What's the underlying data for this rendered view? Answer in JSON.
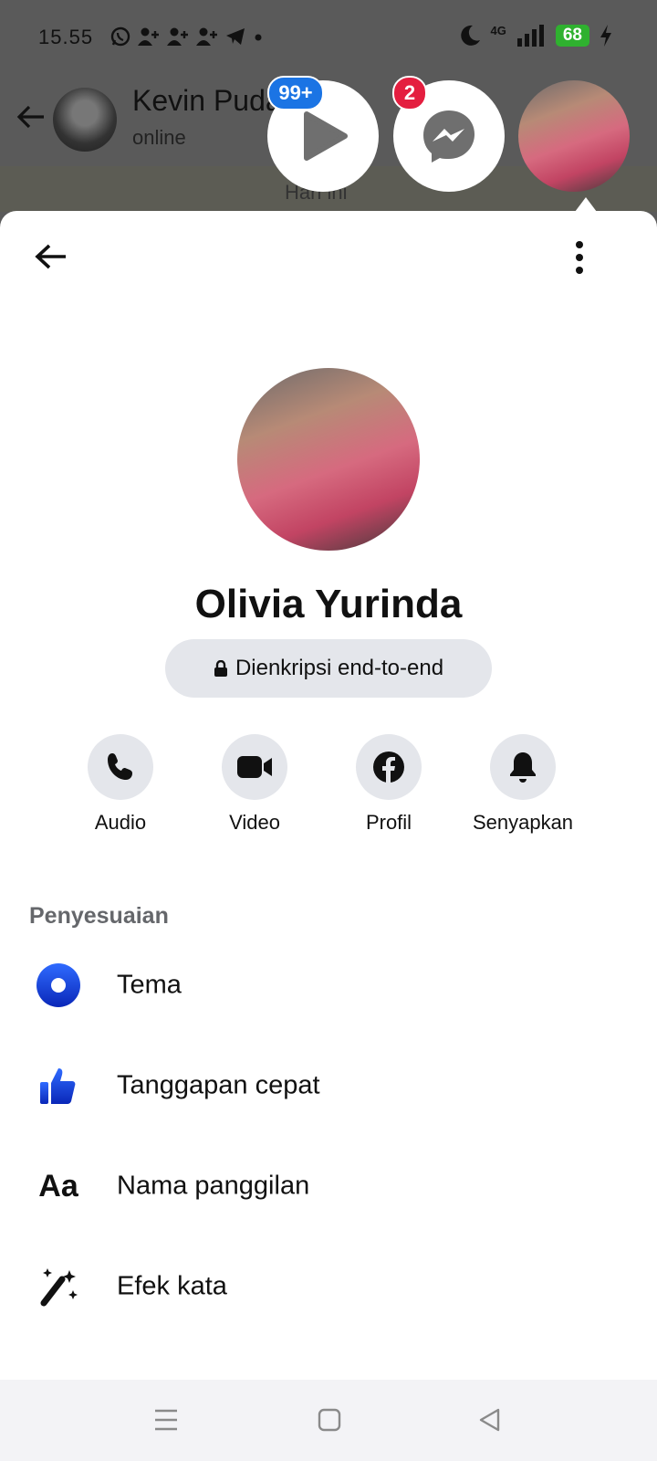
{
  "status_bar": {
    "time": "15.55",
    "network": "4G",
    "battery": "68"
  },
  "whatsapp": {
    "contact_name": "Kevin Pudaa",
    "contact_status": "online",
    "day_label": "Hari ini"
  },
  "chat_heads": {
    "video_badge": "99+",
    "messenger_badge": "2",
    "badge_colors": {
      "video": "#1b74e4",
      "messenger": "#e41e3f"
    }
  },
  "profile": {
    "name": "Olivia Yurinda",
    "encryption_label": "Dienkripsi end-to-end"
  },
  "actions": [
    {
      "label": "Audio",
      "icon": "phone-icon"
    },
    {
      "label": "Video",
      "icon": "video-camera-icon"
    },
    {
      "label": "Profil",
      "icon": "facebook-icon"
    },
    {
      "label": "Senyapkan",
      "icon": "bell-icon"
    }
  ],
  "customization": {
    "title": "Penyesuaian",
    "items": [
      {
        "label": "Tema",
        "icon": "theme-icon"
      },
      {
        "label": "Tanggapan cepat",
        "icon": "thumbs-up-icon"
      },
      {
        "label": "Nama panggilan",
        "icon": "nickname-aa-icon",
        "icon_text": "Aa"
      },
      {
        "label": "Efek kata",
        "icon": "magic-wand-icon"
      }
    ]
  },
  "colors": {
    "accent_blue": "#0a3fd8",
    "grey_fill": "#e4e6eb",
    "section_grey": "#65676b"
  }
}
